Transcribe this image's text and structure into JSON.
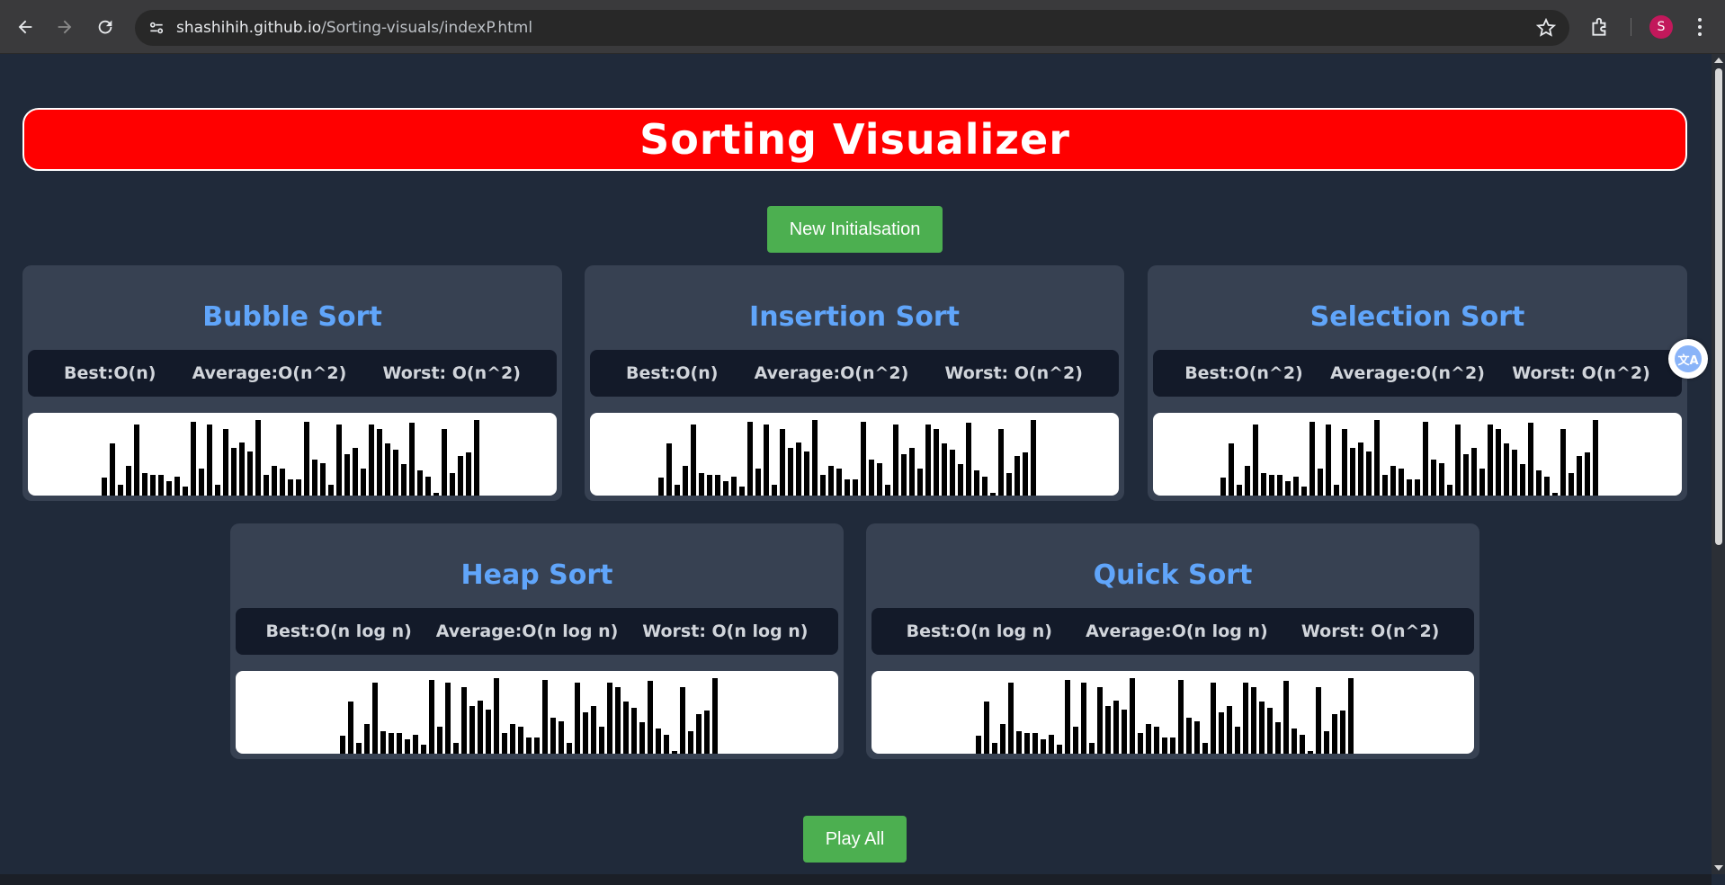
{
  "browser": {
    "url_host": "shashihih.github.io",
    "url_path": "/Sorting-visuals/indexP.html",
    "avatar_letter": "S"
  },
  "page": {
    "title": "Sorting Visualizer",
    "new_button_label": "New Initialsation",
    "play_all_label": "Play All",
    "translate_icon_text": "文A"
  },
  "array": [
    12,
    35,
    7,
    20,
    48,
    15,
    14,
    14,
    10,
    13,
    6,
    50,
    18,
    48,
    7,
    45,
    32,
    36,
    30,
    51,
    14,
    20,
    18,
    11,
    11,
    50,
    24,
    22,
    7,
    48,
    28,
    32,
    18,
    48,
    45,
    35,
    31,
    21,
    49,
    17,
    13,
    2,
    45,
    15,
    27,
    29,
    51
  ],
  "cards": [
    {
      "title": "Bubble Sort",
      "best": "Best:O(n)",
      "average": "Average:O(n^2)",
      "worst": "Worst: O(n^2)"
    },
    {
      "title": "Insertion Sort",
      "best": "Best:O(n)",
      "average": "Average:O(n^2)",
      "worst": "Worst: O(n^2)"
    },
    {
      "title": "Selection Sort",
      "best": "Best:O(n^2)",
      "average": "Average:O(n^2)",
      "worst": "Worst: O(n^2)"
    },
    {
      "title": "Heap Sort",
      "best": "Best:O(n log n)",
      "average": "Average:O(n log n)",
      "worst": "Worst: O(n log n)"
    },
    {
      "title": "Quick Sort",
      "best": "Best:O(n log n)",
      "average": "Average:O(n log n)",
      "worst": "Worst: O(n^2)"
    }
  ],
  "colors": {
    "header_bg": "#ff0000",
    "button_green": "#4caf50",
    "title_blue": "#60a5fa",
    "card_bg": "#374152",
    "page_bg": "#202a3a"
  },
  "icons": [
    "back-arrow-icon",
    "forward-arrow-icon",
    "reload-icon",
    "site-info-icon",
    "bookmark-star-icon",
    "extensions-icon",
    "menu-dots-icon",
    "translate-icon"
  ]
}
